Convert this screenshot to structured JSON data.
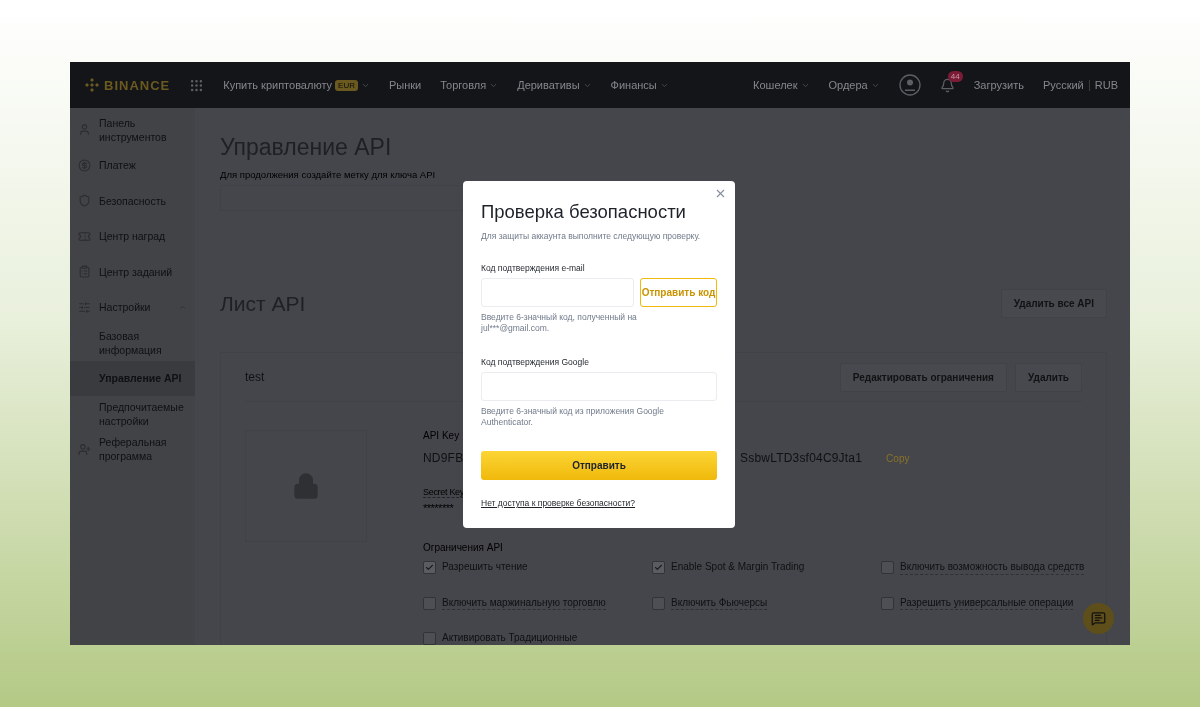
{
  "header": {
    "logo": "BINANCE",
    "nav": [
      {
        "label": "Купить криптовалюту",
        "badge": "EUR",
        "dropdown": true
      },
      {
        "label": "Рынки",
        "dropdown": false
      },
      {
        "label": "Торговля",
        "dropdown": true
      },
      {
        "label": "Деривативы",
        "dropdown": true
      },
      {
        "label": "Финансы",
        "dropdown": true
      }
    ],
    "right_nav": [
      {
        "label": "Кошелек",
        "dropdown": true
      },
      {
        "label": "Ордера",
        "dropdown": true
      }
    ],
    "notification_count": "44",
    "download": "Загрузить",
    "language": "Русский",
    "currency": "RUB"
  },
  "sidebar": {
    "items": [
      {
        "label": "Панель инструментов",
        "selected": false
      },
      {
        "label": "Платеж",
        "selected": false
      },
      {
        "label": "Безопасность",
        "selected": false
      },
      {
        "label": "Центр наград",
        "selected": false
      },
      {
        "label": "Центр заданий",
        "selected": false
      },
      {
        "label": "Настройки",
        "selected": false,
        "expanded": true,
        "children": [
          {
            "label": "Базовая информация",
            "selected": false
          },
          {
            "label": "Управление API",
            "selected": true
          },
          {
            "label": "Предпочитаемые настройки",
            "selected": false
          }
        ]
      },
      {
        "label": "Реферальная программа",
        "selected": false
      }
    ]
  },
  "main": {
    "title": "Управление API",
    "subtitle": "Для продолжения создайте метку для ключа API",
    "list_title": "Лист API",
    "delete_all_button": "Удалить все API",
    "api_card": {
      "name": "test",
      "buttons": [
        "Редактировать ограничения",
        "Удалить"
      ],
      "api_key_label": "API Key",
      "api_key_start": "ND9FB",
      "api_key_end": "SsbwLTD3sf04C9Jta1",
      "copy": "Copy",
      "secret_key_label": "Secret Key",
      "secret_key_value": "********",
      "restrictions_label": "Ограничения API",
      "restrictions": [
        {
          "label": "Разрешить чтение",
          "checked": true,
          "tooltip": false
        },
        {
          "label": "Enable Spot & Margin Trading",
          "checked": true,
          "tooltip": false
        },
        {
          "label": "Включить возможность вывода средств",
          "checked": false,
          "tooltip": true
        },
        {
          "label": "Включить маржинальную торговлю",
          "checked": false,
          "tooltip": true
        },
        {
          "label": "Включить Фьючерсы",
          "checked": false,
          "tooltip": true
        },
        {
          "label": "Разрешить универсальные операции",
          "checked": false,
          "tooltip": true
        },
        {
          "label": "Активировать Традиционные",
          "checked": false,
          "tooltip": false
        }
      ]
    }
  },
  "modal": {
    "title": "Проверка безопасности",
    "subtitle": "Для защиты аккаунта выполните следующую проверку.",
    "email_label": "Код подтверждения e-mail",
    "send_code_button": "Отправить код",
    "email_hint": "Введите 6-значный код, полученный на jul***@gmail.com.",
    "google_label": "Код подтверждения Google",
    "google_hint": "Введите 6-значный код из приложения Google Authenticator.",
    "submit_button": "Отправить",
    "help_link": "Нет доступа к проверке безопасности?"
  }
}
